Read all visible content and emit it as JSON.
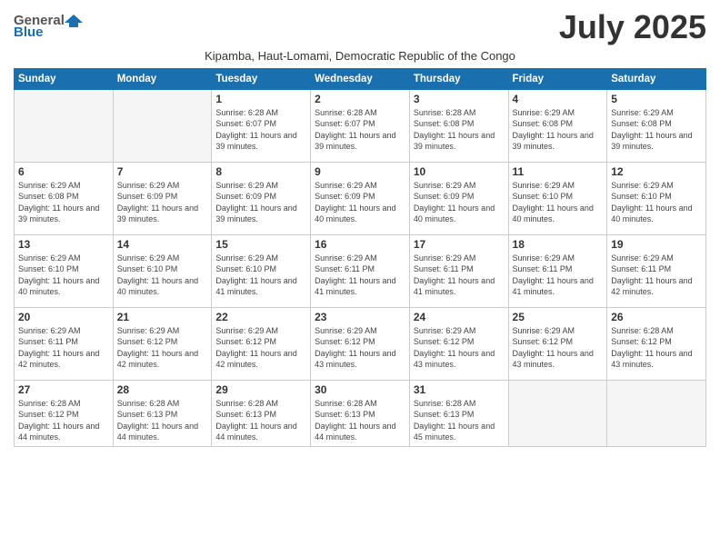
{
  "logo": {
    "general": "General",
    "blue": "Blue"
  },
  "title": "July 2025",
  "subtitle": "Kipamba, Haut-Lomami, Democratic Republic of the Congo",
  "days_of_week": [
    "Sunday",
    "Monday",
    "Tuesday",
    "Wednesday",
    "Thursday",
    "Friday",
    "Saturday"
  ],
  "weeks": [
    [
      {
        "day": "",
        "info": ""
      },
      {
        "day": "",
        "info": ""
      },
      {
        "day": "1",
        "info": "Sunrise: 6:28 AM\nSunset: 6:07 PM\nDaylight: 11 hours and 39 minutes."
      },
      {
        "day": "2",
        "info": "Sunrise: 6:28 AM\nSunset: 6:07 PM\nDaylight: 11 hours and 39 minutes."
      },
      {
        "day": "3",
        "info": "Sunrise: 6:28 AM\nSunset: 6:08 PM\nDaylight: 11 hours and 39 minutes."
      },
      {
        "day": "4",
        "info": "Sunrise: 6:29 AM\nSunset: 6:08 PM\nDaylight: 11 hours and 39 minutes."
      },
      {
        "day": "5",
        "info": "Sunrise: 6:29 AM\nSunset: 6:08 PM\nDaylight: 11 hours and 39 minutes."
      }
    ],
    [
      {
        "day": "6",
        "info": "Sunrise: 6:29 AM\nSunset: 6:08 PM\nDaylight: 11 hours and 39 minutes."
      },
      {
        "day": "7",
        "info": "Sunrise: 6:29 AM\nSunset: 6:09 PM\nDaylight: 11 hours and 39 minutes."
      },
      {
        "day": "8",
        "info": "Sunrise: 6:29 AM\nSunset: 6:09 PM\nDaylight: 11 hours and 39 minutes."
      },
      {
        "day": "9",
        "info": "Sunrise: 6:29 AM\nSunset: 6:09 PM\nDaylight: 11 hours and 40 minutes."
      },
      {
        "day": "10",
        "info": "Sunrise: 6:29 AM\nSunset: 6:09 PM\nDaylight: 11 hours and 40 minutes."
      },
      {
        "day": "11",
        "info": "Sunrise: 6:29 AM\nSunset: 6:10 PM\nDaylight: 11 hours and 40 minutes."
      },
      {
        "day": "12",
        "info": "Sunrise: 6:29 AM\nSunset: 6:10 PM\nDaylight: 11 hours and 40 minutes."
      }
    ],
    [
      {
        "day": "13",
        "info": "Sunrise: 6:29 AM\nSunset: 6:10 PM\nDaylight: 11 hours and 40 minutes."
      },
      {
        "day": "14",
        "info": "Sunrise: 6:29 AM\nSunset: 6:10 PM\nDaylight: 11 hours and 40 minutes."
      },
      {
        "day": "15",
        "info": "Sunrise: 6:29 AM\nSunset: 6:10 PM\nDaylight: 11 hours and 41 minutes."
      },
      {
        "day": "16",
        "info": "Sunrise: 6:29 AM\nSunset: 6:11 PM\nDaylight: 11 hours and 41 minutes."
      },
      {
        "day": "17",
        "info": "Sunrise: 6:29 AM\nSunset: 6:11 PM\nDaylight: 11 hours and 41 minutes."
      },
      {
        "day": "18",
        "info": "Sunrise: 6:29 AM\nSunset: 6:11 PM\nDaylight: 11 hours and 41 minutes."
      },
      {
        "day": "19",
        "info": "Sunrise: 6:29 AM\nSunset: 6:11 PM\nDaylight: 11 hours and 42 minutes."
      }
    ],
    [
      {
        "day": "20",
        "info": "Sunrise: 6:29 AM\nSunset: 6:11 PM\nDaylight: 11 hours and 42 minutes."
      },
      {
        "day": "21",
        "info": "Sunrise: 6:29 AM\nSunset: 6:12 PM\nDaylight: 11 hours and 42 minutes."
      },
      {
        "day": "22",
        "info": "Sunrise: 6:29 AM\nSunset: 6:12 PM\nDaylight: 11 hours and 42 minutes."
      },
      {
        "day": "23",
        "info": "Sunrise: 6:29 AM\nSunset: 6:12 PM\nDaylight: 11 hours and 43 minutes."
      },
      {
        "day": "24",
        "info": "Sunrise: 6:29 AM\nSunset: 6:12 PM\nDaylight: 11 hours and 43 minutes."
      },
      {
        "day": "25",
        "info": "Sunrise: 6:29 AM\nSunset: 6:12 PM\nDaylight: 11 hours and 43 minutes."
      },
      {
        "day": "26",
        "info": "Sunrise: 6:28 AM\nSunset: 6:12 PM\nDaylight: 11 hours and 43 minutes."
      }
    ],
    [
      {
        "day": "27",
        "info": "Sunrise: 6:28 AM\nSunset: 6:12 PM\nDaylight: 11 hours and 44 minutes."
      },
      {
        "day": "28",
        "info": "Sunrise: 6:28 AM\nSunset: 6:13 PM\nDaylight: 11 hours and 44 minutes."
      },
      {
        "day": "29",
        "info": "Sunrise: 6:28 AM\nSunset: 6:13 PM\nDaylight: 11 hours and 44 minutes."
      },
      {
        "day": "30",
        "info": "Sunrise: 6:28 AM\nSunset: 6:13 PM\nDaylight: 11 hours and 44 minutes."
      },
      {
        "day": "31",
        "info": "Sunrise: 6:28 AM\nSunset: 6:13 PM\nDaylight: 11 hours and 45 minutes."
      },
      {
        "day": "",
        "info": ""
      },
      {
        "day": "",
        "info": ""
      }
    ]
  ]
}
